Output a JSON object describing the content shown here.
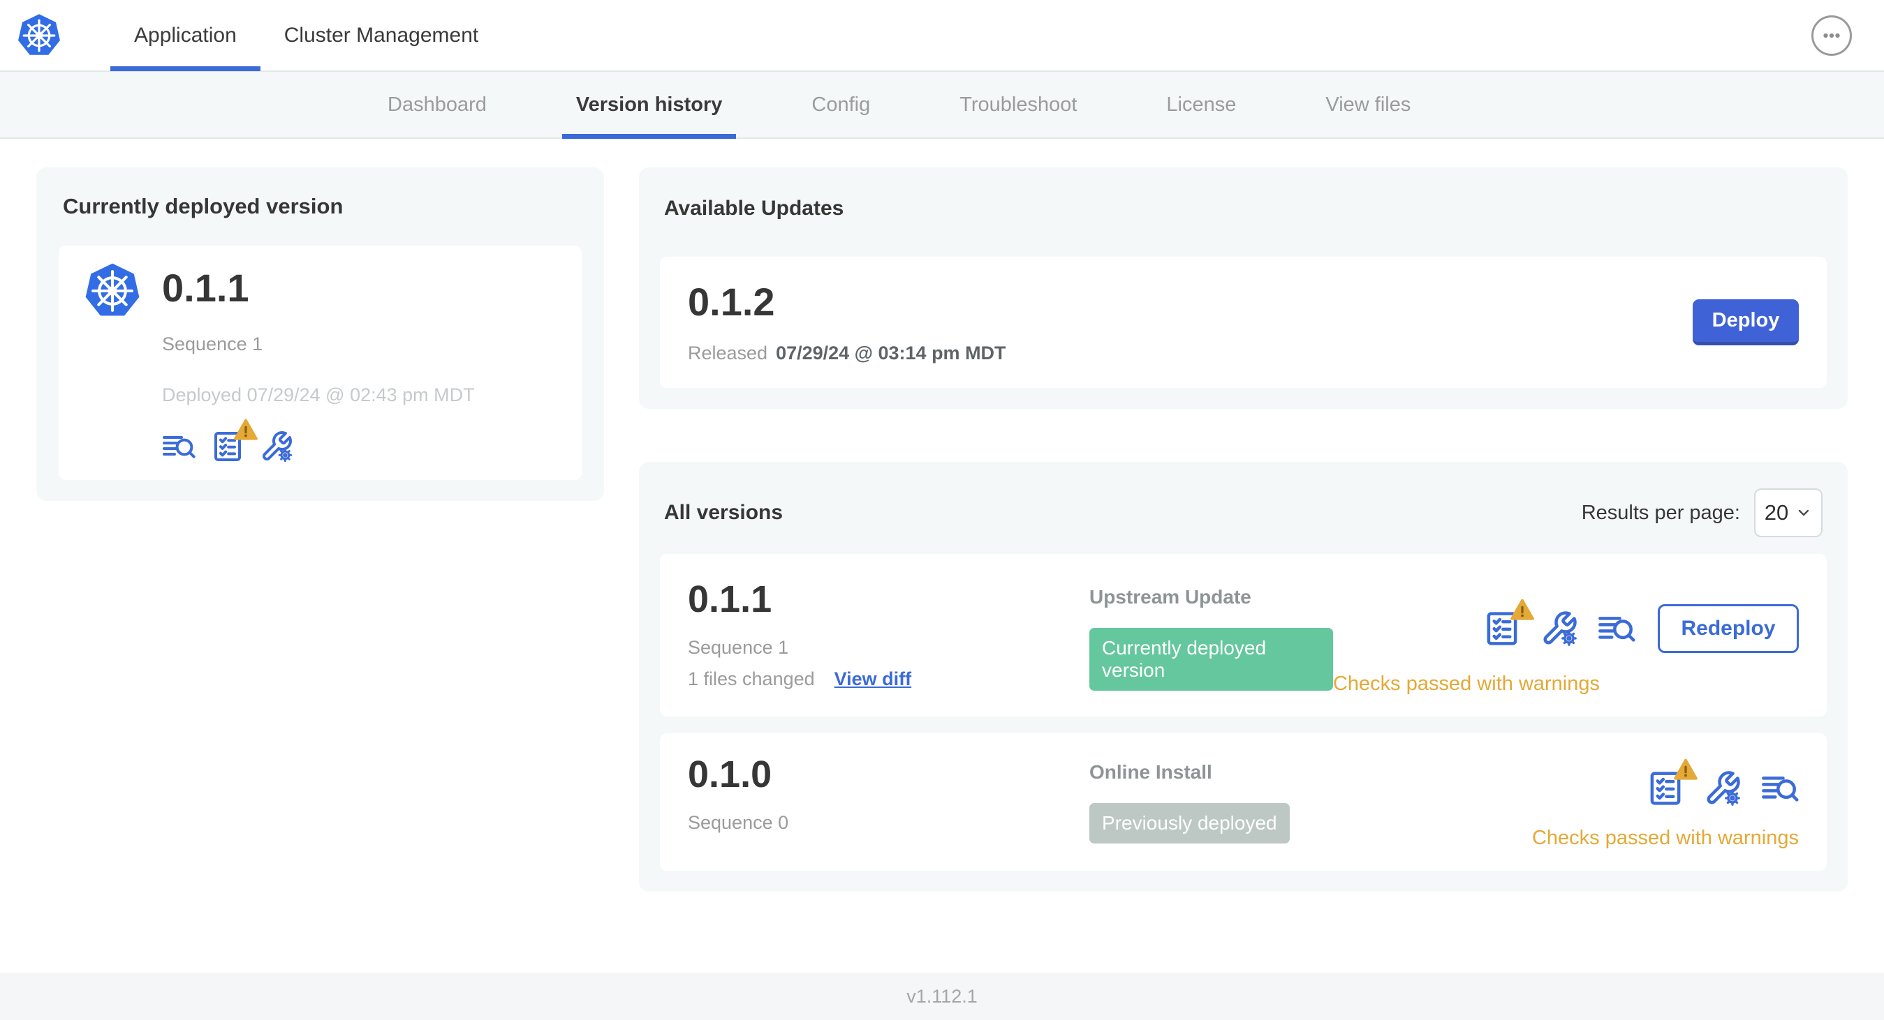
{
  "colors": {
    "accent_blue": "#3b6bd8",
    "logo_blue": "#326de6",
    "deploy_blue": "#3f63d6",
    "badge_green": "#65c79d",
    "badge_gray": "#bdc8c4",
    "warning_orange": "#e4a936",
    "warning_dark": "#8a5d15"
  },
  "header": {
    "tabs": [
      {
        "label": "Application"
      },
      {
        "label": "Cluster Management"
      }
    ],
    "icons": [
      "kubernetes-logo-icon",
      "ellipsis-icon"
    ]
  },
  "subnav": {
    "tabs": [
      {
        "label": "Dashboard"
      },
      {
        "label": "Version history"
      },
      {
        "label": "Config"
      },
      {
        "label": "Troubleshoot"
      },
      {
        "label": "License"
      },
      {
        "label": "View files"
      }
    ],
    "active": "Version history"
  },
  "current_version": {
    "title": "Currently deployed version",
    "version": "0.1.1",
    "sequence": "Sequence 1",
    "deployed": "Deployed 07/29/24 @ 02:43 pm MDT",
    "icons": [
      "logs-search-icon",
      "preflight-checklist-warning-icon",
      "config-wrench-icon"
    ]
  },
  "available_updates": {
    "title": "Available Updates",
    "version": "0.1.2",
    "released_prefix": "Released",
    "released_date": "07/29/24 @ 03:14 pm MDT",
    "deploy_label": "Deploy"
  },
  "all_versions": {
    "title": "All versions",
    "results_per_page_label": "Results per page:",
    "results_per_page_value": "20",
    "rows": [
      {
        "version": "0.1.1",
        "sequence": "Sequence 1",
        "files_changed": "1 files changed",
        "view_diff_label": "View diff",
        "source": "Upstream Update",
        "badge": "Currently deployed version",
        "badge_style": "green",
        "status": "Checks passed with warnings",
        "action_label": "Redeploy",
        "icons": [
          "preflight-checklist-warning-icon",
          "config-wrench-icon",
          "logs-search-icon"
        ]
      },
      {
        "version": "0.1.0",
        "sequence": "Sequence 0",
        "source": "Online Install",
        "badge": "Previously deployed",
        "badge_style": "gray",
        "status": "Checks passed with warnings",
        "icons": [
          "preflight-checklist-warning-icon",
          "config-wrench-icon",
          "logs-search-icon"
        ]
      }
    ]
  },
  "footer": {
    "version": "v1.112.1"
  }
}
